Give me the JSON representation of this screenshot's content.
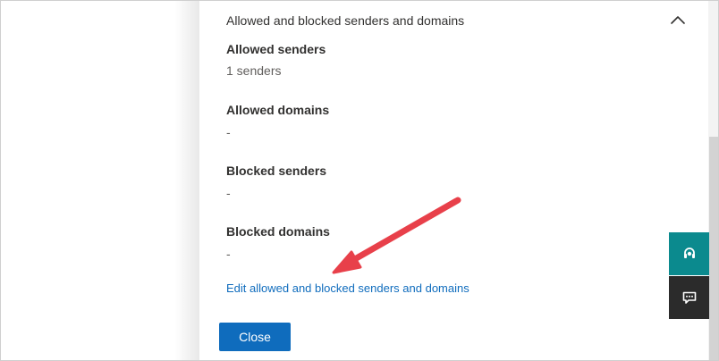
{
  "panel": {
    "section_title": "Allowed and blocked senders and domains",
    "fields": [
      {
        "label": "Allowed senders",
        "value": "1 senders"
      },
      {
        "label": "Allowed domains",
        "value": "-"
      },
      {
        "label": "Blocked senders",
        "value": "-"
      },
      {
        "label": "Blocked domains",
        "value": "-"
      }
    ],
    "edit_link": "Edit allowed and blocked senders and domains",
    "close_button": "Close"
  },
  "colors": {
    "accent": "#0f6cbd",
    "annotation_arrow": "#e8404a",
    "widget_teal": "#0b8a8e",
    "widget_dark": "#2b2b2b"
  },
  "icons": {
    "collapse": "chevron-up-icon",
    "support": "headset-icon",
    "feedback": "chat-icon"
  }
}
